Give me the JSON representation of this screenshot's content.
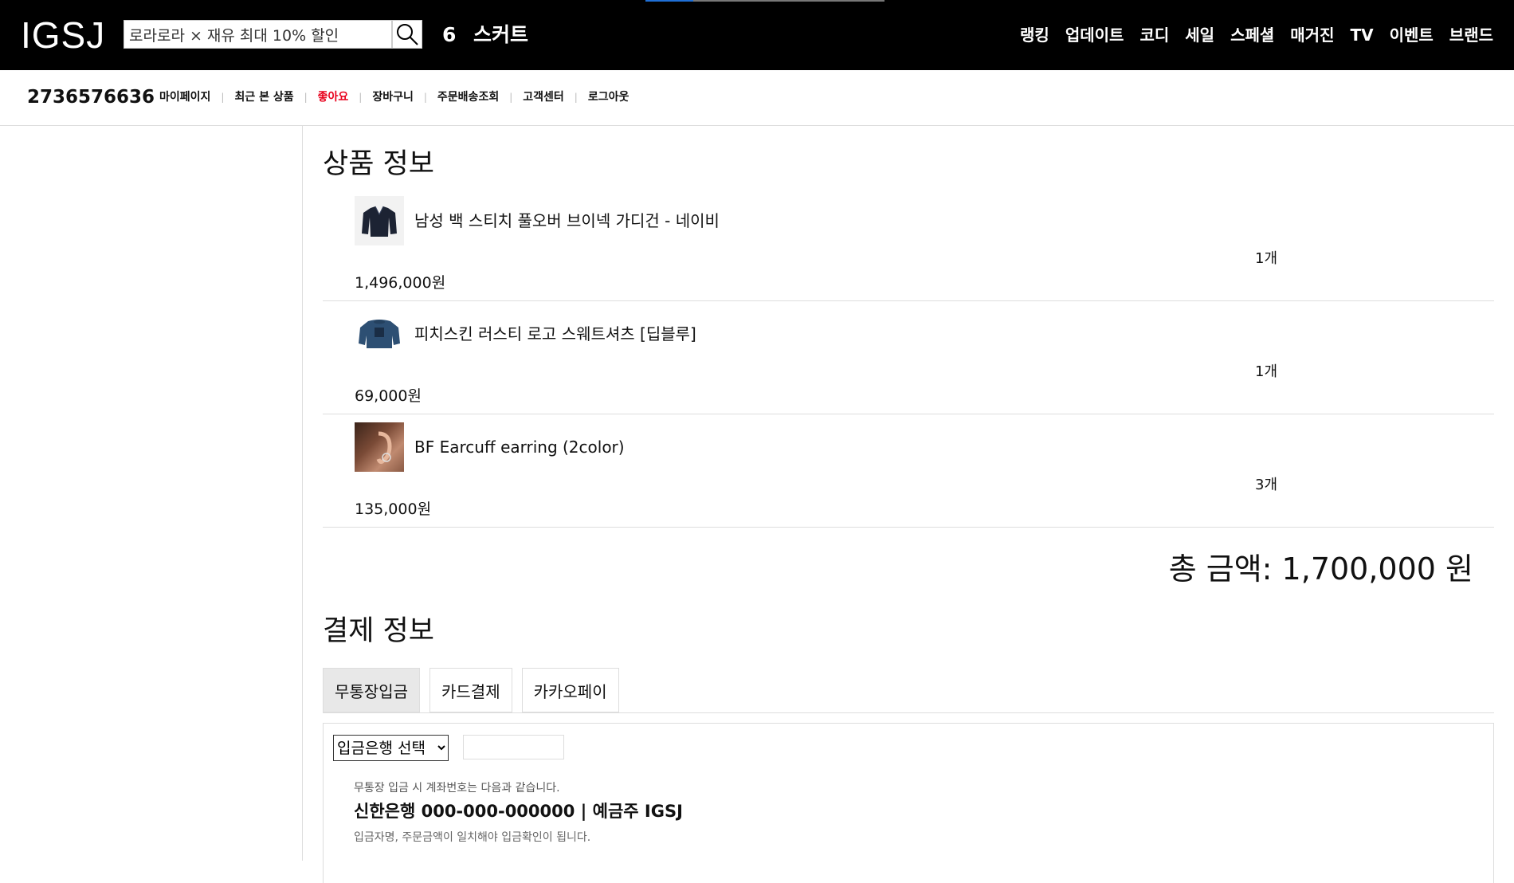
{
  "header": {
    "logo": "IGSJ",
    "search_value": "로라로라 × 재유 최대 10% 할인",
    "category_number": "6",
    "category_name": "스커트",
    "nav": [
      "랭킹",
      "업데이트",
      "코디",
      "세일",
      "스페셜",
      "매거진",
      "TV",
      "이벤트",
      "브랜드"
    ]
  },
  "subnav": {
    "user_id": "2736576636",
    "links": [
      "마이페이지",
      "최근 본 상품",
      "좋아요",
      "장바구니",
      "주문배송조회",
      "고객센터",
      "로그아웃"
    ],
    "highlight_color": "#e8001c"
  },
  "product_section": {
    "title": "상품 정보",
    "items": [
      {
        "name": "남성 백 스티치 풀오버 브이넥 가디건 - 네이비",
        "qty": "1개",
        "price": "1,496,000원",
        "image_icon": "navy-cardigan-image"
      },
      {
        "name": "피치스킨 러스티 로고 스웨트셔츠 [딥블루]",
        "qty": "1개",
        "price": "69,000원",
        "image_icon": "blue-sweatshirt-image"
      },
      {
        "name": "BF Earcuff earring (2color)",
        "qty": "3개",
        "price": "135,000원",
        "image_icon": "earcuff-photo-image"
      }
    ],
    "total": "총 금액: 1,700,000 원"
  },
  "payment_section": {
    "title": "결제 정보",
    "tabs": [
      "무통장입금",
      "카드결제",
      "카카오페이"
    ],
    "active_tab": "무통장입금",
    "bank_select_value": "입금은행 선택",
    "depositor_value": "",
    "note1": "무통장 입금 시 계좌번호는 다음과 같습니다.",
    "account": "신한은행 000-000-000000 | 예금주 IGSJ",
    "note2": "입금자명, 주문금액이 일치해야 입금확인이 됩니다."
  }
}
